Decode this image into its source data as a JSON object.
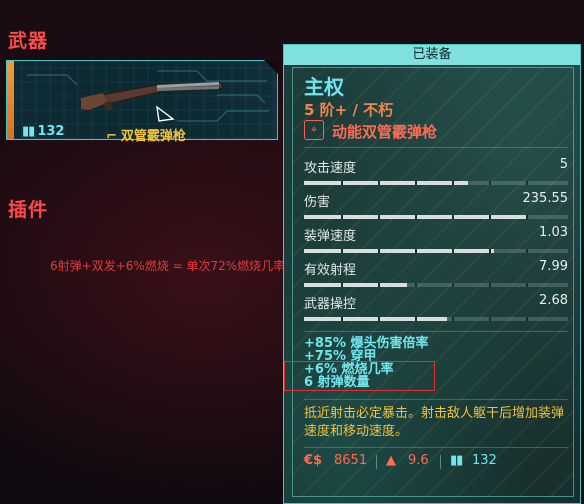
{
  "sections": {
    "weapon": "武器",
    "mods": "插件"
  },
  "weapon_slot": {
    "ammo_icon": "ammo-icon",
    "ammo": "132",
    "name": "双管霰弹枪",
    "rarity_color": "#f59a3a"
  },
  "note": "6射弹+双发+6%燃烧 = 单次72%燃烧几率",
  "panel": {
    "header": "已装备",
    "title": "主权",
    "tier": "5 阶+ / 不朽",
    "type_icon": "power-weapon-icon",
    "type": "动能双管霰弹枪",
    "stats": [
      {
        "label": "攻击速度",
        "value": "5",
        "fill": 0.62
      },
      {
        "label": "伤害",
        "value": "235.55",
        "fill": 0.84
      },
      {
        "label": "装弹速度",
        "value": "1.03",
        "fill": 0.72
      },
      {
        "label": "有效射程",
        "value": "7.99",
        "fill": 0.39
      },
      {
        "label": "武器操控",
        "value": "2.68",
        "fill": 0.54
      }
    ],
    "mods": [
      "+85% 爆头伤害倍率",
      "+75% 穿甲",
      "+6% 燃烧几率",
      "6 射弹数量"
    ],
    "description": "抵近射击必定暴击。射击敌人躯干后增加装弹速度和移动速度。",
    "footer": {
      "price_icon": "€$",
      "price": "8651",
      "weight_icon": "weight-icon",
      "weight": "9.6",
      "ammo_icon": "ammo-icon",
      "ammo": "132"
    }
  },
  "colors": {
    "accent_cyan": "#6fe6ee",
    "accent_red": "#ff4a4a",
    "accent_orange": "#f1864e",
    "accent_yellow": "#f0c23c"
  }
}
